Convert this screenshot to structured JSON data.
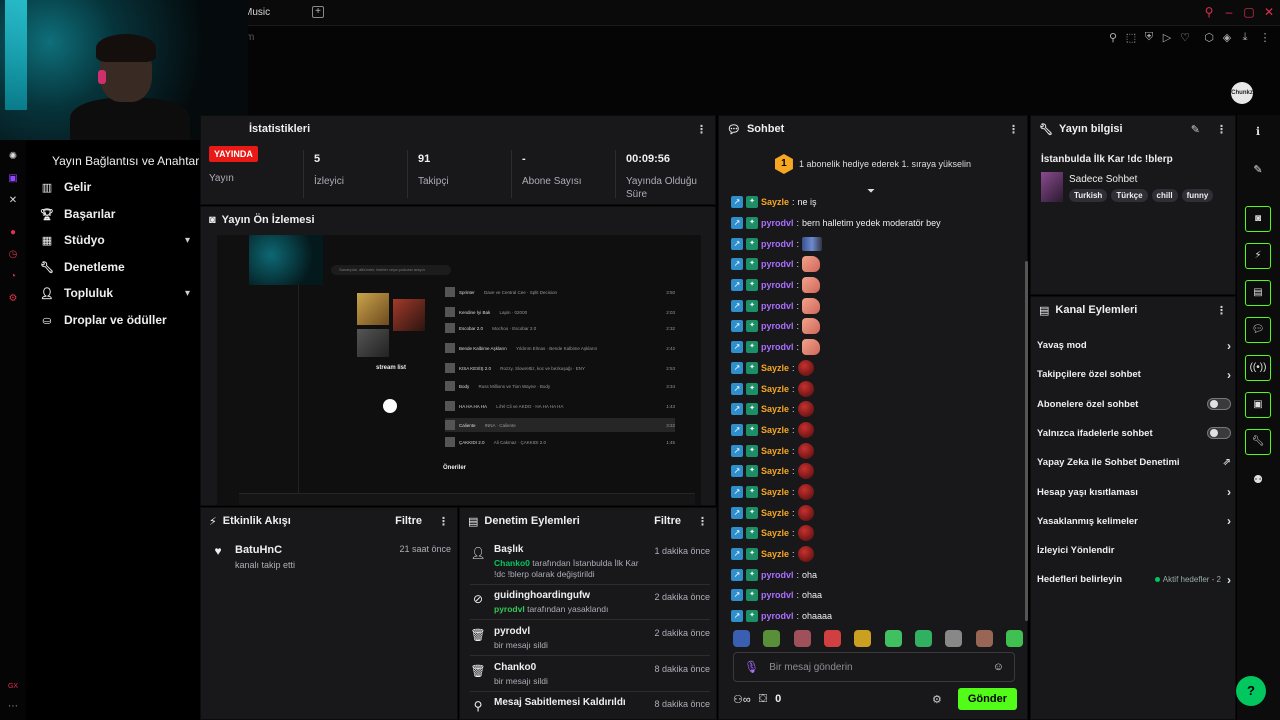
{
  "browser": {
    "tab_label": "Music",
    "tab_add": "+",
    "address_hint": "m",
    "profile_avatar_text": "Chunkz"
  },
  "sidebar": {
    "title": "Yayın Bağlantısı ve Anahtarı",
    "items": [
      {
        "label": "Gelir",
        "icon": "bar-chart-icon"
      },
      {
        "label": "Başarılar",
        "icon": "trophy-icon"
      },
      {
        "label": "Stüdyo",
        "icon": "studio-icon",
        "has_chevron": true
      },
      {
        "label": "Denetleme",
        "icon": "wrench-icon"
      },
      {
        "label": "Topluluk",
        "icon": "community-icon",
        "has_chevron": true
      },
      {
        "label": "Droplar ve ödüller",
        "icon": "drops-icon"
      }
    ]
  },
  "stats": {
    "title": "İstatistikleri",
    "live_badge": "YAYINDA",
    "items": [
      {
        "value": "",
        "label": "Yayın"
      },
      {
        "value": "5",
        "label": "İzleyici"
      },
      {
        "value": "91",
        "label": "Takipçi"
      },
      {
        "value": "-",
        "label": "Abone Sayısı"
      },
      {
        "value": "00:09:56",
        "label": "Yayında Olduğu Süre"
      }
    ]
  },
  "preview": {
    "title": "Yayın Ön İzlemesi",
    "search_placeholder": "Sanatçılar, albümler, listeler veya podcast arayın",
    "playlist_title": "stream list",
    "tracks": [
      {
        "title": "Sprinter",
        "sub": "Dave ve Central Cee · Split Decision",
        "dur": "3:50"
      },
      {
        "title": "Kendine İyi Bak",
        "sub": "Lapin · 02000",
        "dur": "2:03"
      },
      {
        "title": "Escobar 2.0",
        "sub": "Mochoo · Escobar 2.0",
        "dur": "2:32"
      },
      {
        "title": "Bende Kalbime Aşkların",
        "sub": "Yıldırım Elmas · Bende Kalbime Aşkların",
        "dur": "2:42"
      },
      {
        "title": "KISA KESİŞ 2.0",
        "sub": "Rozzy, Slowrettiz, koc ve bezkuşağı · ENY",
        "dur": "2:53"
      },
      {
        "title": "Body",
        "sub": "Russ Millions ve Tion Wayne · Body",
        "dur": "3:34"
      },
      {
        "title": "HA HA HA HA",
        "sub": "Lil'el Cli ve AKDO · HA HA HA HA",
        "dur": "1:43"
      },
      {
        "title": "Caliente",
        "sub": "INNA · Caliente",
        "dur": "3:22"
      },
      {
        "title": "ÇAKKIDI 2.0",
        "sub": "Ali Cakmaz · ÇAKKIDI 2.0",
        "dur": "1:45"
      }
    ],
    "recommend_label": "Öneriler"
  },
  "activity": {
    "title": "Etkinlik Akışı",
    "filter": "Filtre",
    "items": [
      {
        "name": "BatuHnC",
        "sub": "kanalı takip etti",
        "time": "21 saat önce"
      }
    ]
  },
  "moderation": {
    "title": "Denetim Eylemleri",
    "filter": "Filtre",
    "items": [
      {
        "name": "Başlık",
        "actor": "Chanko0",
        "text": "tarafından İstanbulda İlk Kar !dc !blerp olarak değiştirildi",
        "time": "1 dakika önce",
        "icon": "person-edit-icon"
      },
      {
        "name": "guidinghoardingufw",
        "actor": "pyrodvl",
        "text": "tarafından yasaklandı",
        "time": "2 dakika önce",
        "icon": "ban-icon"
      },
      {
        "name": "pyrodvl",
        "actor": "",
        "text": "bir mesajı sildi",
        "time": "2 dakika önce",
        "icon": "trash-icon"
      },
      {
        "name": "Chanko0",
        "actor": "",
        "text": "bir mesajı sildi",
        "time": "8 dakika önce",
        "icon": "trash-icon"
      },
      {
        "name": "Mesaj Sabitlemesi Kaldırıldı",
        "actor": "",
        "text": "",
        "time": "8 dakika önce",
        "icon": "unpin-icon"
      }
    ]
  },
  "chat": {
    "title": "Sohbet",
    "banner_num": "1",
    "banner_text": "1 abonelik hediye ederek 1. sıraya yükselin",
    "messages": [
      {
        "user": "Sayzle",
        "color": "#f5a623",
        "text": "ne iş",
        "emote": ""
      },
      {
        "user": "pyrodvl",
        "color": "#a970ff",
        "text": "bern halletim yedek moderatör bey",
        "emote": ""
      },
      {
        "user": "pyrodvl",
        "color": "#a970ff",
        "text": "",
        "emote": "flag"
      },
      {
        "user": "pyrodvl",
        "color": "#a970ff",
        "text": "",
        "emote": "hand"
      },
      {
        "user": "pyrodvl",
        "color": "#a970ff",
        "text": "",
        "emote": "hand"
      },
      {
        "user": "pyrodvl",
        "color": "#a970ff",
        "text": "",
        "emote": "hand"
      },
      {
        "user": "pyrodvl",
        "color": "#a970ff",
        "text": "",
        "emote": "hand"
      },
      {
        "user": "pyrodvl",
        "color": "#a970ff",
        "text": "",
        "emote": "hand"
      },
      {
        "user": "Sayzle",
        "color": "#f5a623",
        "text": "",
        "emote": "red"
      },
      {
        "user": "Sayzle",
        "color": "#f5a623",
        "text": "",
        "emote": "red"
      },
      {
        "user": "Sayzle",
        "color": "#f5a623",
        "text": "",
        "emote": "red"
      },
      {
        "user": "Sayzle",
        "color": "#f5a623",
        "text": "",
        "emote": "red"
      },
      {
        "user": "Sayzle",
        "color": "#f5a623",
        "text": "",
        "emote": "red"
      },
      {
        "user": "Sayzle",
        "color": "#f5a623",
        "text": "",
        "emote": "red"
      },
      {
        "user": "Sayzle",
        "color": "#f5a623",
        "text": "",
        "emote": "red"
      },
      {
        "user": "Sayzle",
        "color": "#f5a623",
        "text": "",
        "emote": "red"
      },
      {
        "user": "Sayzle",
        "color": "#f5a623",
        "text": "",
        "emote": "red"
      },
      {
        "user": "Sayzle",
        "color": "#f5a623",
        "text": "",
        "emote": "red"
      },
      {
        "user": "pyrodvl",
        "color": "#a970ff",
        "text": "oha",
        "emote": ""
      },
      {
        "user": "pyrodvl",
        "color": "#a970ff",
        "text": "ohaa",
        "emote": ""
      },
      {
        "user": "pyrodvl",
        "color": "#a970ff",
        "text": "ohaaaa",
        "emote": ""
      }
    ],
    "emote_colors": [
      "#3a5fb0",
      "#5a8f3a",
      "#a0505a",
      "#d04040",
      "#c9a020",
      "#40c060",
      "#30b060",
      "#888888",
      "#996655",
      "#40c050"
    ],
    "input_placeholder": "Bir mesaj gönderin",
    "viewers_count": "0",
    "send_label": "Gönder"
  },
  "stream_info": {
    "header": "Yayın bilgisi",
    "title": "İstanbulda İlk Kar !dc !blerp",
    "category": "Sadece Sohbet",
    "tags": [
      "Turkish",
      "Türkçe",
      "chill",
      "funny"
    ]
  },
  "channel_actions": {
    "title": "Kanal Eylemleri",
    "items": [
      {
        "label": "Yavaş mod",
        "control": "chevron"
      },
      {
        "label": "Takipçilere özel sohbet",
        "control": "chevron"
      },
      {
        "label": "Abonelere özel sohbet",
        "control": "toggle"
      },
      {
        "label": "Yalnızca ifadelerle sohbet",
        "control": "toggle"
      },
      {
        "label": "Yapay Zeka ile Sohbet Denetimi",
        "control": "external"
      },
      {
        "label": "Hesap yaşı kısıtlaması",
        "control": "chevron"
      },
      {
        "label": "Yasaklanmış kelimeler",
        "control": "chevron"
      },
      {
        "label": "İzleyici Yönlendir",
        "control": "none"
      },
      {
        "label": "Hedefleri belirleyin",
        "control": "chevron",
        "sub": "Aktif hedefler - 2"
      }
    ]
  },
  "colors": {
    "accent": "#53fc18",
    "live": "#e91916",
    "pyrodvl": "#a970ff",
    "sayzle": "#f5a623"
  }
}
